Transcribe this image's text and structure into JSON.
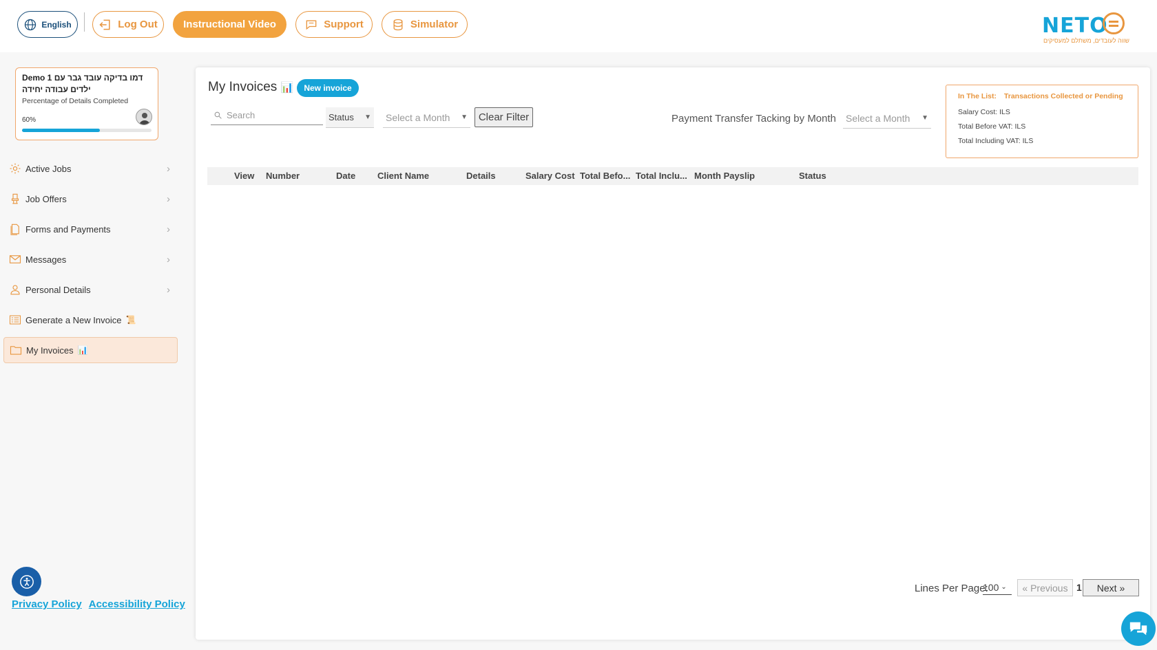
{
  "topbar": {
    "language_label": "English",
    "logout_label": "Log Out",
    "video_label": "Instructional Video",
    "support_label": "Support",
    "simulator_label": "Simulator",
    "logo_word": "NETO",
    "logo_tagline": "שווה לעובדים, משתלם למעסיקים"
  },
  "profile": {
    "name": "Demo 1 דמו בדיקה עובד גבר עם ילדים עבודה יחידה",
    "subtitle": "Percentage of Details Completed",
    "percent_label": "60%",
    "percent_value": 0.6
  },
  "sidebar": {
    "items": [
      {
        "label": "Active Jobs",
        "icon": "gear-icon"
      },
      {
        "label": "Job Offers",
        "icon": "chair-icon"
      },
      {
        "label": "Forms and Payments",
        "icon": "document-icon"
      },
      {
        "label": "Messages",
        "icon": "mail-icon"
      },
      {
        "label": "Personal Details",
        "icon": "user-icon"
      },
      {
        "label": "Generate a New Invoice",
        "icon": "invoice-icon",
        "emoji": "📜"
      },
      {
        "label": "My Invoices",
        "icon": "folder-icon",
        "emoji": "📊"
      }
    ]
  },
  "footer": {
    "privacy": "Privacy Policy",
    "accessibility": "Accessibility Policy"
  },
  "main": {
    "title": "My Invoices",
    "title_emoji": "📊",
    "new_invoice": "New invoice",
    "search_placeholder": "Search",
    "status_select": "Status",
    "month_select": "Select a Month",
    "clear_filter": "Clear Filter",
    "tracking_label": "Payment Transfer Tacking by Month",
    "month_select2": "Select a Month"
  },
  "summary": {
    "in_list": "In The List:",
    "filter": "Transactions Collected or Pending",
    "salary_cost": "Salary Cost: ILS",
    "before_vat": "Total Before VAT: ILS",
    "incl_vat": "Total Including VAT: ILS"
  },
  "table": {
    "columns": [
      "View",
      "Number",
      "Date",
      "Client Name",
      "Details",
      "Salary Cost",
      "Total Befo...",
      "Total Inclu...",
      "Month Payslip",
      "Status"
    ]
  },
  "pagination": {
    "lines_label": "Lines Per Page:",
    "lines_value": "100",
    "previous": "« Previous",
    "page": "1",
    "next": "Next »"
  },
  "colors": {
    "accent_orange": "#e8963f",
    "accent_blue": "#16a4d8"
  }
}
